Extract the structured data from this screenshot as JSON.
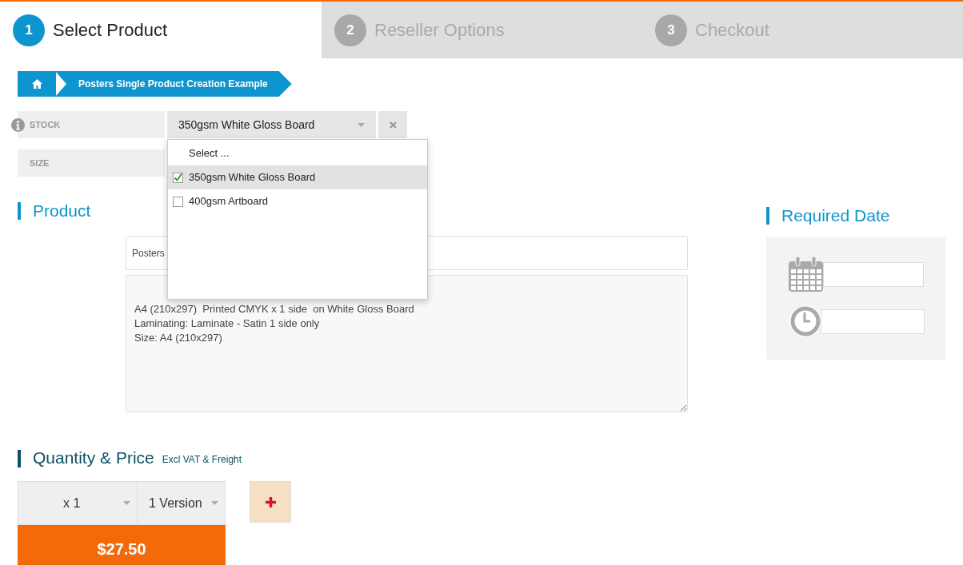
{
  "steps": [
    {
      "number": "1",
      "label": "Select Product",
      "selected": true
    },
    {
      "number": "2",
      "label": "Reseller Options",
      "selected": false
    },
    {
      "number": "3",
      "label": "Checkout",
      "selected": false
    }
  ],
  "breadcrumb": {
    "current": "Posters Single Product Creation Example"
  },
  "options": [
    {
      "label": "STOCK",
      "value": "350gsm White Gloss Board",
      "kind": "select"
    },
    {
      "label": "SIZE",
      "kind": "select"
    }
  ],
  "stock_dropdown": [
    {
      "label": "Select ...",
      "kind": "placeholder"
    },
    {
      "label": "350gsm White Gloss Board",
      "kind": "option",
      "checked": true,
      "selected": true
    },
    {
      "label": "400gsm Artboard",
      "kind": "option",
      "checked": false,
      "selected": false
    }
  ],
  "product": {
    "heading": "Product",
    "name": "Posters",
    "description": "A4 (210x297)  Printed CMYK x 1 side  on White Gloss Board\nLaminating: Laminate - Satin 1 side only\nSize: A4 (210x297)"
  },
  "required_date": {
    "heading": "Required Date"
  },
  "quantity_price": {
    "heading": "Quantity & Price",
    "note": "Excl VAT & Freight",
    "quantity": "x 1",
    "versions": "1 Version",
    "price": "$27.50"
  }
}
